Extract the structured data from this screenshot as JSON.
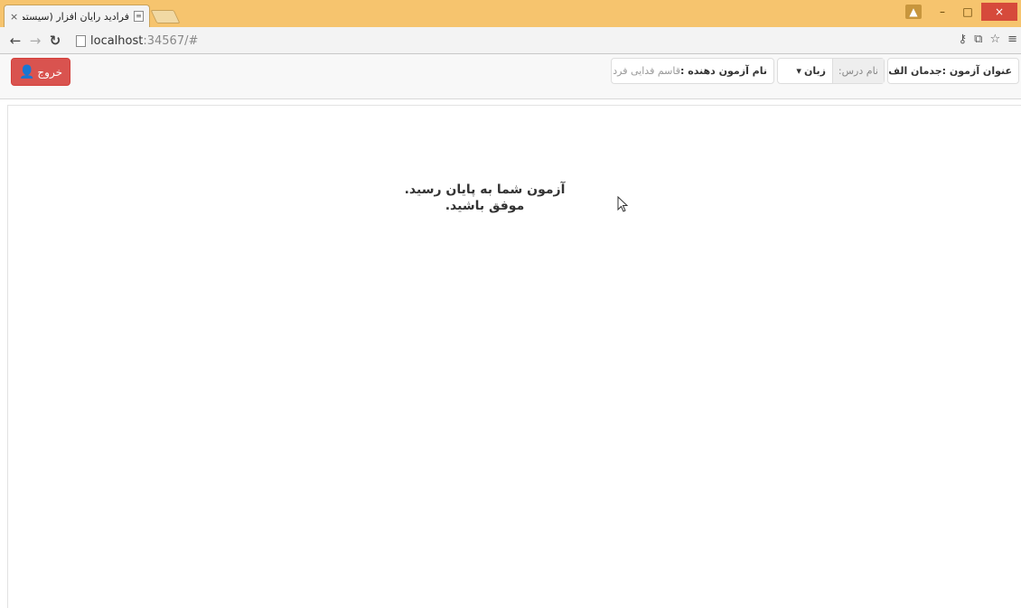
{
  "browser": {
    "tab_title": "فرادید رایان افزار (سیستم برگ",
    "tab_close": "×",
    "url_host": "localhost",
    "url_rest": ":34567/#",
    "win_min": "–",
    "win_max": "□",
    "win_close": "×"
  },
  "header": {
    "logout_label": "خروج",
    "exam_title_label": "عنوان آزمون :",
    "exam_title_value": "جدمان الف",
    "course_label": "نام درس:",
    "course_value": "زبان",
    "examiner_label": "نام آزمون دهنده :",
    "examiner_value": "قاسم فدایی فرد"
  },
  "main": {
    "line1": "آزمون شما به پایان رسید.",
    "line2": "موفق باشید."
  },
  "colors": {
    "titlebar": "#f6c46e",
    "danger": "#d9534f"
  }
}
